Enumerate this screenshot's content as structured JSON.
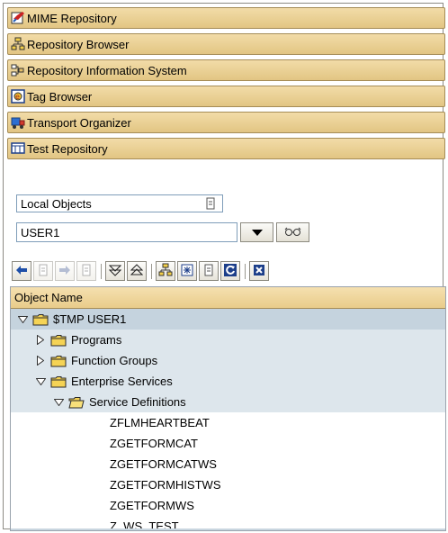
{
  "nav_buttons": [
    {
      "label": "MIME Repository",
      "icon": "mime-repository-icon"
    },
    {
      "label": "Repository Browser",
      "icon": "repository-browser-icon"
    },
    {
      "label": "Repository Information System",
      "icon": "information-system-icon"
    },
    {
      "label": "Tag Browser",
      "icon": "tag-browser-icon"
    },
    {
      "label": "Transport Organizer",
      "icon": "transport-truck-icon"
    },
    {
      "label": "Test Repository",
      "icon": "test-repository-icon"
    }
  ],
  "object_selector": {
    "type_value": "Local Objects",
    "user_value": "USER1"
  },
  "tree": {
    "header": "Object Name",
    "rows": [
      {
        "label": "$TMP USER1",
        "level": 0,
        "toggle": "expanded",
        "icon": "folder"
      },
      {
        "label": "Programs",
        "level": 1,
        "toggle": "collapsed",
        "icon": "folder"
      },
      {
        "label": "Function Groups",
        "level": 1,
        "toggle": "collapsed",
        "icon": "folder"
      },
      {
        "label": "Enterprise Services",
        "level": 1,
        "toggle": "expanded",
        "icon": "folder"
      },
      {
        "label": "Service Definitions",
        "level": 2,
        "toggle": "expanded",
        "icon": "folder-open"
      },
      {
        "label": "ZFLMHEARTBEAT",
        "level": 3,
        "toggle": "none",
        "icon": "none"
      },
      {
        "label": "ZGETFORMCAT",
        "level": 3,
        "toggle": "none",
        "icon": "none"
      },
      {
        "label": "ZGETFORMCATWS",
        "level": 3,
        "toggle": "none",
        "icon": "none"
      },
      {
        "label": "ZGETFORMHISTWS",
        "level": 3,
        "toggle": "none",
        "icon": "none"
      },
      {
        "label": "ZGETFORMWS",
        "level": 3,
        "toggle": "none",
        "icon": "none"
      },
      {
        "label": "Z_WS_TEST",
        "level": 3,
        "toggle": "none",
        "icon": "none"
      }
    ]
  },
  "colors": {
    "nav_button": "#e9cf92",
    "tree_highlight": "#dde6ec",
    "tree_selected": "#c5d3de"
  }
}
